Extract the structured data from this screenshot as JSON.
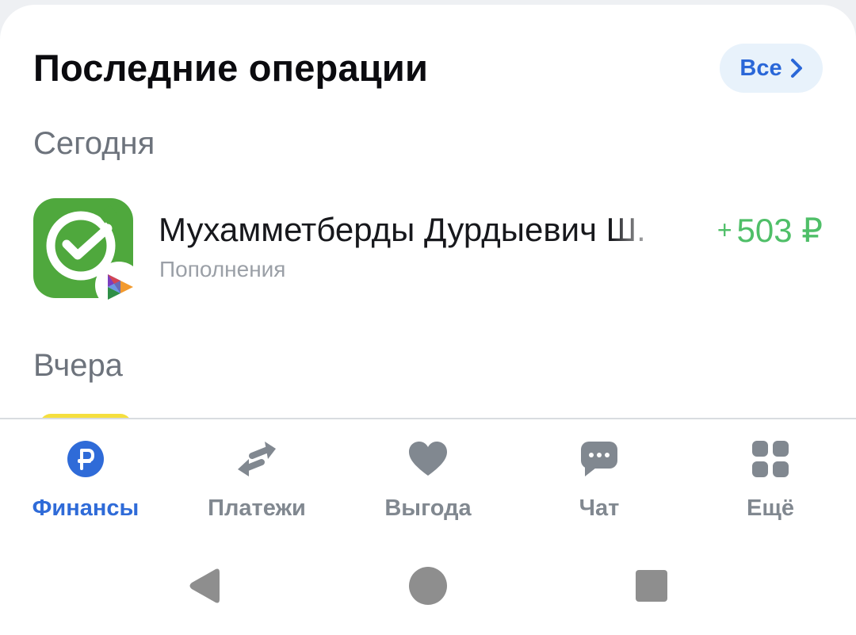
{
  "recent": {
    "title": "Последние операции",
    "all_button_label": "Все"
  },
  "groups": [
    {
      "label": "Сегодня",
      "operations": [
        {
          "name": "Мухамметберды Дурдыевич Ш.",
          "category": "Пополнения",
          "amount_sign": "+",
          "amount": "503 ₽",
          "icon": "sberbank-logo-icon",
          "badge_icon": "sbp-icon"
        }
      ]
    },
    {
      "label": "Вчера",
      "operations": []
    }
  ],
  "tabbar": {
    "items": [
      {
        "label": "Финансы",
        "icon": "ruble-icon",
        "active": true
      },
      {
        "label": "Платежи",
        "icon": "transfer-arrows-icon",
        "active": false
      },
      {
        "label": "Выгода",
        "icon": "heart-icon",
        "active": false
      },
      {
        "label": "Чат",
        "icon": "chat-bubble-icon",
        "active": false
      },
      {
        "label": "Ещё",
        "icon": "grid-icon",
        "active": false
      }
    ]
  },
  "colors": {
    "accent": "#2f6bd8",
    "positive_amount": "#4fbf68",
    "tab_inactive": "#818890",
    "sber_green": "#4fa83d"
  },
  "system_nav": [
    "back-icon",
    "home-icon",
    "recents-icon"
  ]
}
